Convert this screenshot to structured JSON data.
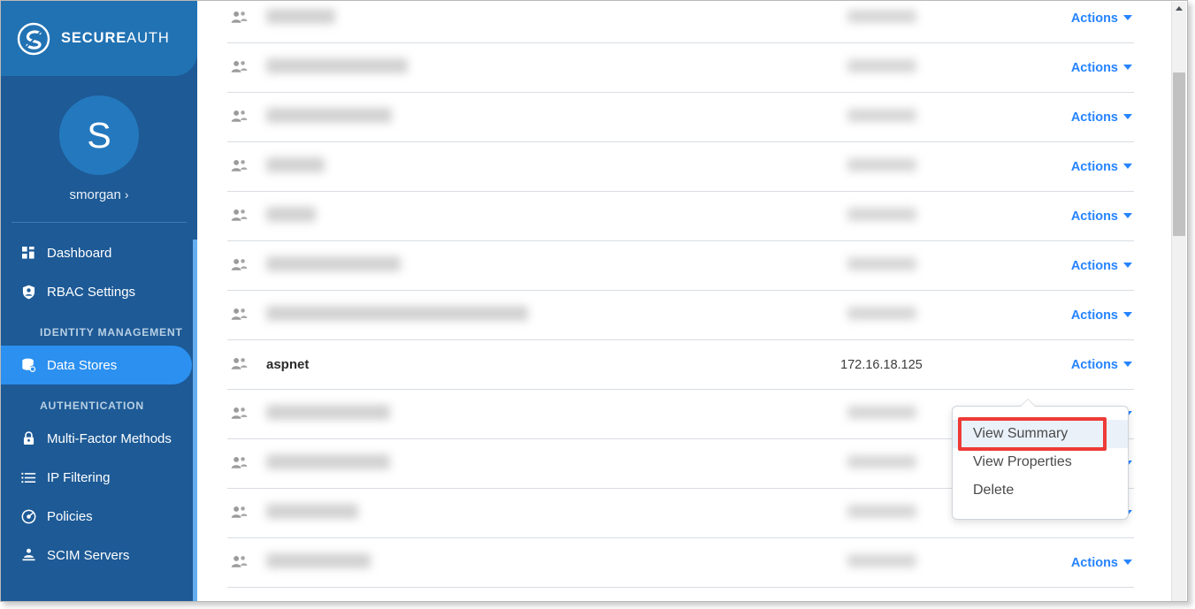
{
  "brand": {
    "name_bold": "SECURE",
    "name_light": "AUTH",
    "logo_icon": "secureauth-logo-icon"
  },
  "sidebar": {
    "user": {
      "initial": "S",
      "name": "smorgan",
      "chevron": "›"
    },
    "items": [
      {
        "label": "Dashboard",
        "icon": "dashboard-grid-icon",
        "active": false,
        "type": "item"
      },
      {
        "label": "RBAC Settings",
        "icon": "shield-user-icon",
        "active": false,
        "type": "item"
      },
      {
        "label": "IDENTITY MANAGEMENT",
        "type": "section"
      },
      {
        "label": "Data Stores",
        "icon": "database-icon",
        "active": true,
        "type": "item"
      },
      {
        "label": "AUTHENTICATION",
        "type": "section"
      },
      {
        "label": "Multi-Factor Methods",
        "icon": "lock-icon",
        "active": false,
        "type": "item"
      },
      {
        "label": "IP Filtering",
        "icon": "list-icon",
        "active": false,
        "type": "item"
      },
      {
        "label": "Policies",
        "icon": "policy-target-icon",
        "active": false,
        "type": "item"
      },
      {
        "label": "SCIM Servers",
        "icon": "server-person-icon",
        "active": false,
        "type": "item"
      }
    ]
  },
  "colors": {
    "sidebar_bg": "#1D5A96",
    "sidebar_header_bg": "#2172B3",
    "active_item_bg": "#2B90F0",
    "link_blue": "#2684FF",
    "highlight_red": "#EE3A37",
    "hover_bg": "#EAF1F9"
  },
  "table": {
    "row_icon": "users-group-icon",
    "actions_label": "Actions",
    "rows": [
      {
        "name": "",
        "ip": "",
        "redacted": true,
        "name_width": 78,
        "actions": "Actions"
      },
      {
        "name": "",
        "ip": "",
        "redacted": true,
        "name_width": 160,
        "actions": "Actions"
      },
      {
        "name": "",
        "ip": "",
        "redacted": true,
        "name_width": 142,
        "actions": "Actions"
      },
      {
        "name": "",
        "ip": "",
        "redacted": true,
        "name_width": 66,
        "actions": "Actions"
      },
      {
        "name": "",
        "ip": "",
        "redacted": true,
        "name_width": 56,
        "actions": "Actions"
      },
      {
        "name": "",
        "ip": "",
        "redacted": true,
        "name_width": 152,
        "actions": "Actions"
      },
      {
        "name": "",
        "ip": "",
        "redacted": true,
        "name_width": 296,
        "actions": "Actions"
      },
      {
        "name": "aspnet",
        "ip": "172.16.18.125",
        "redacted": false,
        "name_width": 0,
        "actions": "Actions"
      },
      {
        "name": "",
        "ip": "",
        "redacted": true,
        "name_width": 140,
        "actions": "Actions"
      },
      {
        "name": "",
        "ip": "",
        "redacted": true,
        "name_width": 140,
        "actions": "Actions"
      },
      {
        "name": "",
        "ip": "",
        "redacted": true,
        "name_width": 104,
        "actions": "Actions"
      },
      {
        "name": "",
        "ip": "",
        "redacted": true,
        "name_width": 118,
        "actions": "Actions"
      }
    ]
  },
  "context_menu": {
    "items": [
      {
        "label": "View Summary",
        "hovered": true
      },
      {
        "label": "View Properties",
        "hovered": false
      },
      {
        "label": "Delete",
        "hovered": false
      }
    ]
  },
  "scrollbar": {
    "up_arrow_icon": "scroll-up-arrow-icon",
    "thumb": "scrollbar-thumb"
  }
}
